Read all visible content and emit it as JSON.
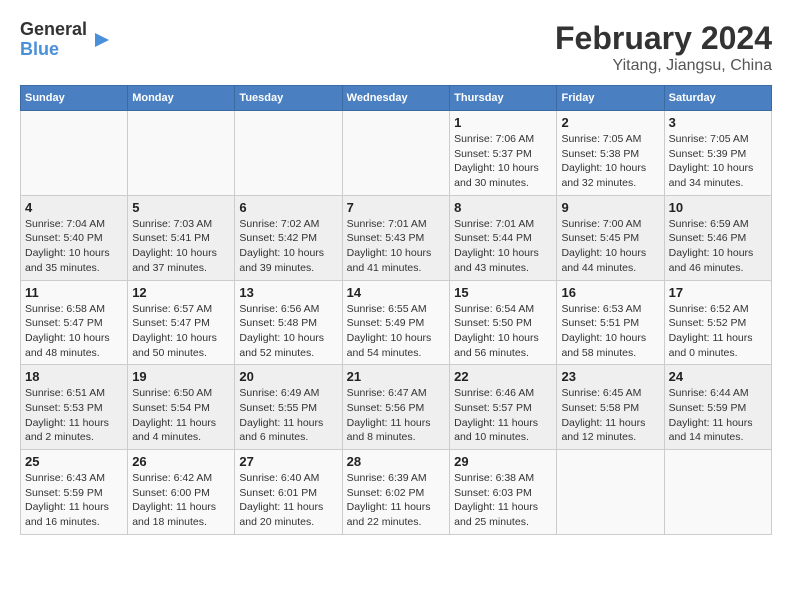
{
  "logo": {
    "text_general": "General",
    "text_blue": "Blue"
  },
  "title": "February 2024",
  "subtitle": "Yitang, Jiangsu, China",
  "weekdays": [
    "Sunday",
    "Monday",
    "Tuesday",
    "Wednesday",
    "Thursday",
    "Friday",
    "Saturday"
  ],
  "weeks": [
    [
      {
        "day": "",
        "info": ""
      },
      {
        "day": "",
        "info": ""
      },
      {
        "day": "",
        "info": ""
      },
      {
        "day": "",
        "info": ""
      },
      {
        "day": "1",
        "info": "Sunrise: 7:06 AM\nSunset: 5:37 PM\nDaylight: 10 hours\nand 30 minutes."
      },
      {
        "day": "2",
        "info": "Sunrise: 7:05 AM\nSunset: 5:38 PM\nDaylight: 10 hours\nand 32 minutes."
      },
      {
        "day": "3",
        "info": "Sunrise: 7:05 AM\nSunset: 5:39 PM\nDaylight: 10 hours\nand 34 minutes."
      }
    ],
    [
      {
        "day": "4",
        "info": "Sunrise: 7:04 AM\nSunset: 5:40 PM\nDaylight: 10 hours\nand 35 minutes."
      },
      {
        "day": "5",
        "info": "Sunrise: 7:03 AM\nSunset: 5:41 PM\nDaylight: 10 hours\nand 37 minutes."
      },
      {
        "day": "6",
        "info": "Sunrise: 7:02 AM\nSunset: 5:42 PM\nDaylight: 10 hours\nand 39 minutes."
      },
      {
        "day": "7",
        "info": "Sunrise: 7:01 AM\nSunset: 5:43 PM\nDaylight: 10 hours\nand 41 minutes."
      },
      {
        "day": "8",
        "info": "Sunrise: 7:01 AM\nSunset: 5:44 PM\nDaylight: 10 hours\nand 43 minutes."
      },
      {
        "day": "9",
        "info": "Sunrise: 7:00 AM\nSunset: 5:45 PM\nDaylight: 10 hours\nand 44 minutes."
      },
      {
        "day": "10",
        "info": "Sunrise: 6:59 AM\nSunset: 5:46 PM\nDaylight: 10 hours\nand 46 minutes."
      }
    ],
    [
      {
        "day": "11",
        "info": "Sunrise: 6:58 AM\nSunset: 5:47 PM\nDaylight: 10 hours\nand 48 minutes."
      },
      {
        "day": "12",
        "info": "Sunrise: 6:57 AM\nSunset: 5:47 PM\nDaylight: 10 hours\nand 50 minutes."
      },
      {
        "day": "13",
        "info": "Sunrise: 6:56 AM\nSunset: 5:48 PM\nDaylight: 10 hours\nand 52 minutes."
      },
      {
        "day": "14",
        "info": "Sunrise: 6:55 AM\nSunset: 5:49 PM\nDaylight: 10 hours\nand 54 minutes."
      },
      {
        "day": "15",
        "info": "Sunrise: 6:54 AM\nSunset: 5:50 PM\nDaylight: 10 hours\nand 56 minutes."
      },
      {
        "day": "16",
        "info": "Sunrise: 6:53 AM\nSunset: 5:51 PM\nDaylight: 10 hours\nand 58 minutes."
      },
      {
        "day": "17",
        "info": "Sunrise: 6:52 AM\nSunset: 5:52 PM\nDaylight: 11 hours\nand 0 minutes."
      }
    ],
    [
      {
        "day": "18",
        "info": "Sunrise: 6:51 AM\nSunset: 5:53 PM\nDaylight: 11 hours\nand 2 minutes."
      },
      {
        "day": "19",
        "info": "Sunrise: 6:50 AM\nSunset: 5:54 PM\nDaylight: 11 hours\nand 4 minutes."
      },
      {
        "day": "20",
        "info": "Sunrise: 6:49 AM\nSunset: 5:55 PM\nDaylight: 11 hours\nand 6 minutes."
      },
      {
        "day": "21",
        "info": "Sunrise: 6:47 AM\nSunset: 5:56 PM\nDaylight: 11 hours\nand 8 minutes."
      },
      {
        "day": "22",
        "info": "Sunrise: 6:46 AM\nSunset: 5:57 PM\nDaylight: 11 hours\nand 10 minutes."
      },
      {
        "day": "23",
        "info": "Sunrise: 6:45 AM\nSunset: 5:58 PM\nDaylight: 11 hours\nand 12 minutes."
      },
      {
        "day": "24",
        "info": "Sunrise: 6:44 AM\nSunset: 5:59 PM\nDaylight: 11 hours\nand 14 minutes."
      }
    ],
    [
      {
        "day": "25",
        "info": "Sunrise: 6:43 AM\nSunset: 5:59 PM\nDaylight: 11 hours\nand 16 minutes."
      },
      {
        "day": "26",
        "info": "Sunrise: 6:42 AM\nSunset: 6:00 PM\nDaylight: 11 hours\nand 18 minutes."
      },
      {
        "day": "27",
        "info": "Sunrise: 6:40 AM\nSunset: 6:01 PM\nDaylight: 11 hours\nand 20 minutes."
      },
      {
        "day": "28",
        "info": "Sunrise: 6:39 AM\nSunset: 6:02 PM\nDaylight: 11 hours\nand 22 minutes."
      },
      {
        "day": "29",
        "info": "Sunrise: 6:38 AM\nSunset: 6:03 PM\nDaylight: 11 hours\nand 25 minutes."
      },
      {
        "day": "",
        "info": ""
      },
      {
        "day": "",
        "info": ""
      }
    ]
  ]
}
